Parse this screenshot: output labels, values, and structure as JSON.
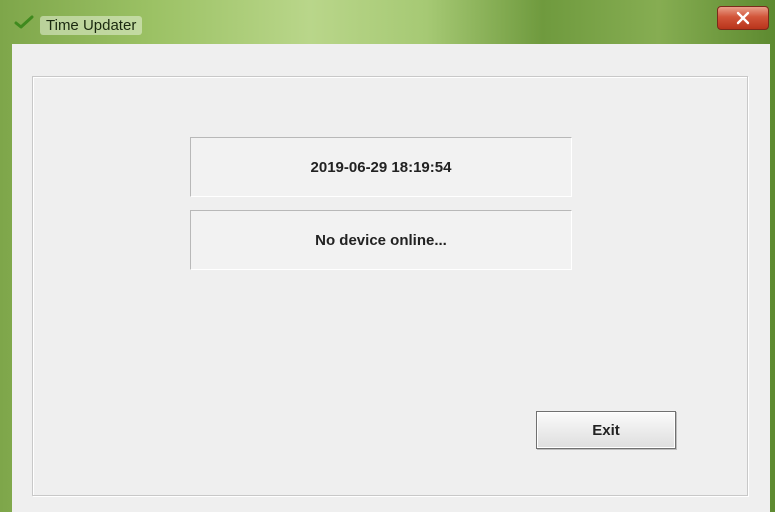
{
  "window": {
    "title": "Time Updater",
    "app_icon": "checkmark-icon",
    "close_icon": "close-icon"
  },
  "display": {
    "datetime": "2019-06-29 18:19:54",
    "status": "No device online..."
  },
  "actions": {
    "exit_label": "Exit"
  },
  "colors": {
    "titlebar_accent": "#7ea64a",
    "close_button": "#c8452a",
    "client_background": "#efefef"
  }
}
